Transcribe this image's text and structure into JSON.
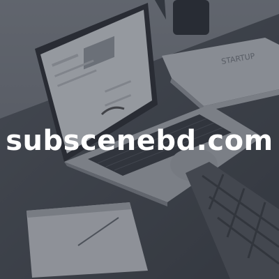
{
  "site": {
    "name": "subscenebd.com"
  },
  "book": {
    "cover_title": "STARTUP"
  },
  "colors": {
    "overlay": "#262c36",
    "text": "#ffffff"
  }
}
